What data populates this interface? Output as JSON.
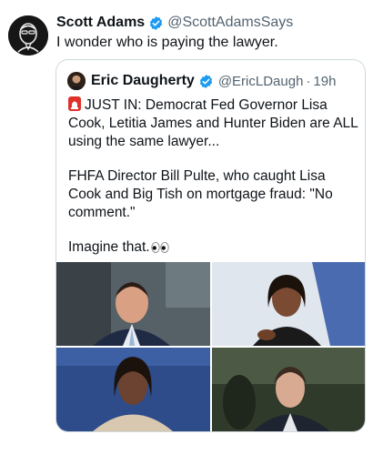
{
  "post": {
    "author_name": "Scott Adams",
    "author_handle": "@ScottAdamsSays",
    "text": "I wonder who is paying the lawyer.",
    "verified": true
  },
  "quoted_post": {
    "author_name": "Eric Daugherty",
    "author_handle": "@EricLDaugh",
    "separator": "·",
    "time": "19h",
    "verified": true,
    "paragraphs": [
      "JUST IN: Democrat Fed Governor Lisa Cook, Letitia James and Hunter Biden are ALL using the same lawyer...",
      "FHFA Director Bill Pulte, who caught Lisa Cook and Big Tish on mortgage fraud: \"No comment.\"",
      "Imagine that."
    ],
    "leading_emoji": "police-siren-icon",
    "trailing_emoji": "eyes-icon",
    "media": [
      {
        "name": "photo-man-suit"
      },
      {
        "name": "photo-woman-speaking"
      },
      {
        "name": "photo-woman-courtroom"
      },
      {
        "name": "photo-man-outdoors"
      }
    ]
  },
  "colors": {
    "verified_blue": "#1d9bf0",
    "secondary_text": "#536471",
    "border": "#cfd9de",
    "siren_red": "#e0322b"
  }
}
